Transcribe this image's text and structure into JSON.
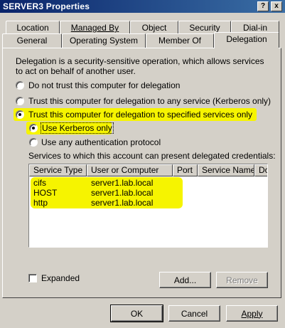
{
  "window": {
    "title": "SERVER3 Properties",
    "help_button": "?",
    "close_button": "x"
  },
  "tabs_row1": [
    "Location",
    "Managed By",
    "Object",
    "Security",
    "Dial-in"
  ],
  "tabs_row2": [
    "General",
    "Operating System",
    "Member Of",
    "Delegation"
  ],
  "active_tab": "Delegation",
  "delegation": {
    "description": "Delegation is a security-sensitive operation, which allows services to act on behalf of another user.",
    "option_no_trust": "Do not trust this computer for delegation",
    "option_trust_any": "Trust this computer for delegation to any service (Kerberos only)",
    "option_trust_specified": "Trust this computer for delegation to specified services only",
    "sub_option_kerberos": "Use Kerberos only",
    "sub_option_any_protocol": "Use any authentication protocol",
    "services_label": "Services to which this account can present delegated credentials:",
    "selected_option": "trust_specified",
    "selected_sub_option": "kerberos"
  },
  "services_table": {
    "columns": [
      "Service Type",
      "User or Computer",
      "Port",
      "Service Name",
      "Do"
    ],
    "rows": [
      {
        "service_type": "cifs",
        "user_or_computer": "server1.lab.local",
        "port": "",
        "service_name": ""
      },
      {
        "service_type": "HOST",
        "user_or_computer": "server1.lab.local",
        "port": "",
        "service_name": ""
      },
      {
        "service_type": "http",
        "user_or_computer": "server1.lab.local",
        "port": "",
        "service_name": ""
      }
    ]
  },
  "expanded_checkbox": {
    "label": "Expanded",
    "checked": false
  },
  "buttons": {
    "add": "Add...",
    "remove": "Remove",
    "ok": "OK",
    "cancel": "Cancel",
    "apply": "Apply"
  },
  "colors": {
    "highlight": "#f6f400",
    "titlebar": "#0a246a",
    "face": "#d4d0c8"
  }
}
